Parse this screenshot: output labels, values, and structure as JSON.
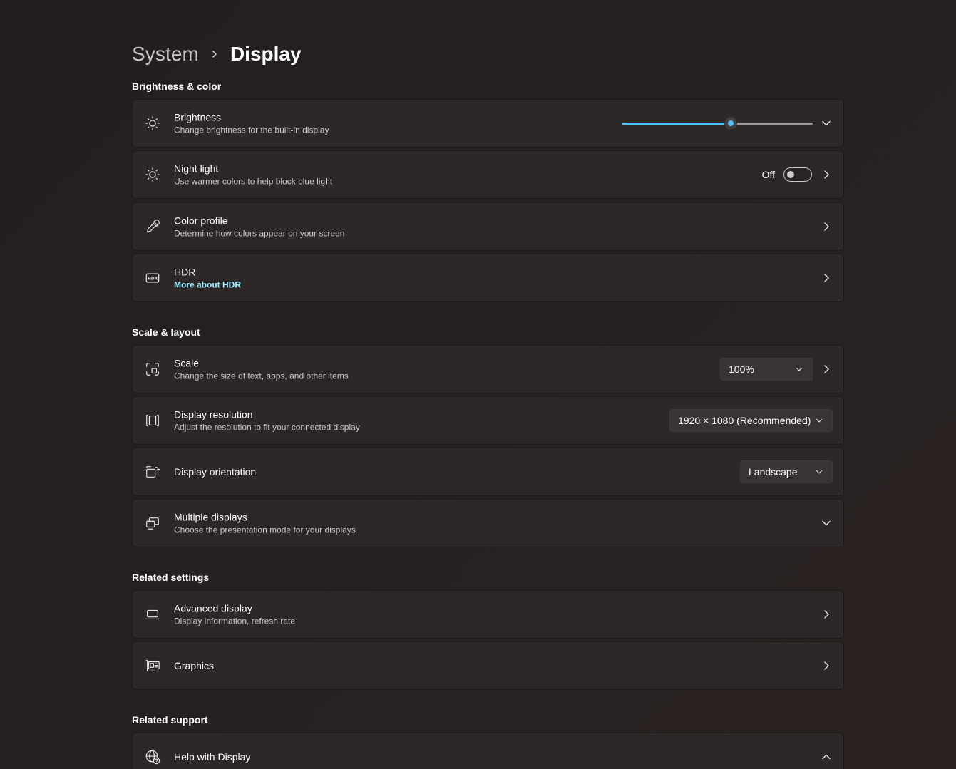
{
  "breadcrumb": {
    "parent": "System",
    "current": "Display"
  },
  "sections": {
    "brightness_color": "Brightness & color",
    "scale_layout": "Scale & layout",
    "related_settings": "Related settings",
    "related_support": "Related support"
  },
  "brightness": {
    "title": "Brightness",
    "subtitle": "Change brightness for the built-in display",
    "level_percent": 57
  },
  "night_light": {
    "title": "Night light",
    "subtitle": "Use warmer colors to help block blue light",
    "state_label": "Off"
  },
  "color_profile": {
    "title": "Color profile",
    "subtitle": "Determine how colors appear on your screen"
  },
  "hdr": {
    "title": "HDR",
    "link": "More about HDR"
  },
  "scale": {
    "title": "Scale",
    "subtitle": "Change the size of text, apps, and other items",
    "value": "100%"
  },
  "resolution": {
    "title": "Display resolution",
    "subtitle": "Adjust the resolution to fit your connected display",
    "value": "1920 × 1080 (Recommended)"
  },
  "orientation": {
    "title": "Display orientation",
    "value": "Landscape"
  },
  "multiple_displays": {
    "title": "Multiple displays",
    "subtitle": "Choose the presentation mode for your displays"
  },
  "advanced_display": {
    "title": "Advanced display",
    "subtitle": "Display information, refresh rate"
  },
  "graphics": {
    "title": "Graphics"
  },
  "help": {
    "title": "Help with Display"
  },
  "colors": {
    "accent": "#4cc2ff",
    "link": "#99ebff",
    "card": "#2d2727"
  },
  "icons": {
    "brightness": "sun-icon",
    "night_light": "night-light-icon",
    "color_profile": "eyedropper-icon",
    "hdr": "hdr-icon",
    "scale": "scale-icon",
    "resolution": "resolution-icon",
    "orientation": "orientation-icon",
    "multiple_displays": "multiple-displays-icon",
    "advanced_display": "laptop-icon",
    "graphics": "graphics-card-icon",
    "help": "globe-help-icon"
  }
}
